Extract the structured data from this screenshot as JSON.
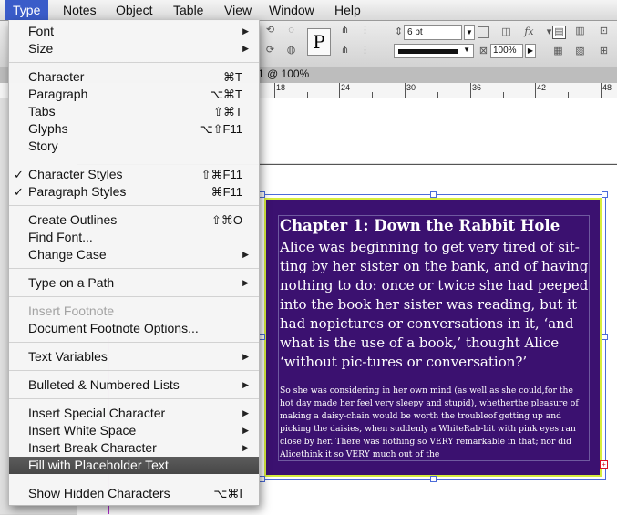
{
  "menubar": {
    "items": [
      {
        "label": "Type",
        "active": true
      },
      {
        "label": "Notes"
      },
      {
        "label": "Object"
      },
      {
        "label": "Table"
      },
      {
        "label": "View"
      },
      {
        "label": "Window"
      },
      {
        "label": "Help"
      }
    ]
  },
  "control_panel": {
    "stroke_weight": "6 pt",
    "tint_percent": "100%",
    "type_on_path_glyph": "P"
  },
  "doc_tab": {
    "label": "1 @ 100%"
  },
  "ruler": {
    "labels": [
      "18",
      "24",
      "30",
      "36",
      "42",
      "48"
    ]
  },
  "type_menu": {
    "items": [
      {
        "label": "Font",
        "submenu": true
      },
      {
        "label": "Size",
        "submenu": true
      },
      {
        "label": "Character",
        "shortcut": "⌘T"
      },
      {
        "label": "Paragraph",
        "shortcut": "⌥⌘T"
      },
      {
        "label": "Tabs",
        "shortcut": "⇧⌘T"
      },
      {
        "label": "Glyphs",
        "shortcut": "⌥⇧F11"
      },
      {
        "label": "Story"
      },
      {
        "label": "Character Styles",
        "shortcut": "⇧⌘F11",
        "checked": true
      },
      {
        "label": "Paragraph Styles",
        "shortcut": "⌘F11",
        "checked": true
      },
      {
        "label": "Create Outlines",
        "shortcut": "⇧⌘O"
      },
      {
        "label": "Find Font..."
      },
      {
        "label": "Change Case",
        "submenu": true
      },
      {
        "label": "Type on a Path",
        "submenu": true
      },
      {
        "label": "Insert Footnote",
        "disabled": true
      },
      {
        "label": "Document Footnote Options..."
      },
      {
        "label": "Text Variables",
        "submenu": true
      },
      {
        "label": "Bulleted & Numbered Lists",
        "submenu": true
      },
      {
        "label": "Insert Special Character",
        "submenu": true
      },
      {
        "label": "Insert White Space",
        "submenu": true
      },
      {
        "label": "Insert Break Character",
        "submenu": true
      },
      {
        "label": "Fill with Placeholder Text",
        "highlighted": true
      },
      {
        "label": "Show Hidden Characters",
        "shortcut": "⌥⌘I"
      }
    ],
    "check_glyph": "✓",
    "arrow_glyph": "▶"
  },
  "document": {
    "heading": "Chapter 1: Down the Rabbit Hole",
    "paragraph_1": "Alice was beginning to get very tired of sit-ting by her sister on the bank, and of having nothing to do:  once or twice she had peeped into the book her sister was reading, but it had nopictures or conversations in it, ‘and what is the use of a book,’ thought Alice ‘without pic-tures or conversation?’",
    "paragraph_2": "So she was considering in her own mind (as well as she could,for the hot day made her feel very sleepy and stupid), whetherthe pleasure of making a daisy-chain would be worth the troubleof getting up and picking the daisies, when suddenly a WhiteRab-bit with pink eyes ran close by her.  There was nothing so VERY remarkable in that; nor did Alicethink it so VERY much out of the",
    "overset_mark": "+"
  },
  "colors": {
    "menubar_active": "#3a5cc9",
    "menu_highlight": "#4d4d4d",
    "frame_fill": "#3b1170",
    "frame_stroke": "#d7ec3d",
    "selection": "#4b6bd9",
    "margin_guide": "#b02bd0"
  }
}
